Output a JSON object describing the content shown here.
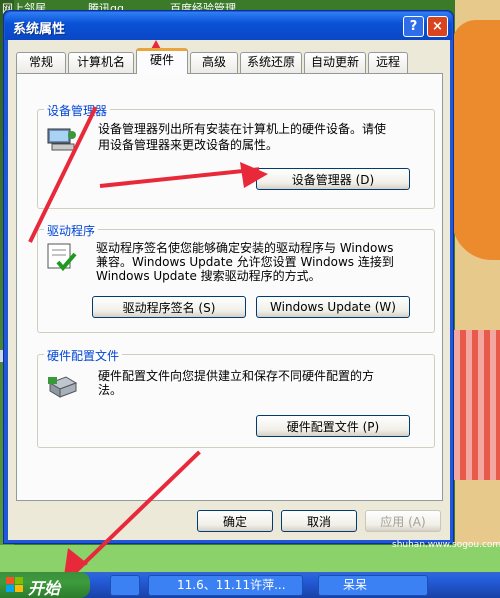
{
  "desktop": {
    "top_items": [
      "网上邻居",
      "腾讯qq",
      "百度经验管理"
    ]
  },
  "window": {
    "title": "系统属性",
    "help_label": "?",
    "close_label": "×"
  },
  "tabs": [
    {
      "label": "常规"
    },
    {
      "label": "计算机名"
    },
    {
      "label": "硬件",
      "active": true
    },
    {
      "label": "高级"
    },
    {
      "label": "系统还原"
    },
    {
      "label": "自动更新"
    },
    {
      "label": "远程"
    }
  ],
  "device_manager": {
    "title": "设备管理器",
    "desc_line1": "设备管理器列出所有安装在计算机上的硬件设备。请使",
    "desc_line2": "用设备管理器来更改设备的属性。",
    "button": "设备管理器 (D)"
  },
  "drivers": {
    "title": "驱动程序",
    "desc_line1": "驱动程序签名使您能够确定安装的驱动程序与 Windows",
    "desc_line2": "兼容。Windows Update 允许您设置 Windows 连接到",
    "desc_line3": "Windows Update 搜索驱动程序的方式。",
    "button_signing": "驱动程序签名 (S)",
    "button_update": "Windows Update (W)"
  },
  "hardware_profiles": {
    "title": "硬件配置文件",
    "desc_line1": "硬件配置文件向您提供建立和保存不同硬件配置的方",
    "desc_line2": "法。",
    "button": "硬件配置文件 (P)"
  },
  "footer": {
    "ok": "确定",
    "cancel": "取消",
    "apply": "应用 (A)"
  },
  "taskbar": {
    "start": "开始",
    "task1": "11.6、11.11许萍...",
    "task2": "呆呆"
  },
  "watermark": "shuhan.www.sogou.com",
  "colors": {
    "title_blue": "#0a52d8",
    "group_title": "#0046d5",
    "annotation_red": "#e8293a",
    "start_green": "#3d9c3d"
  }
}
